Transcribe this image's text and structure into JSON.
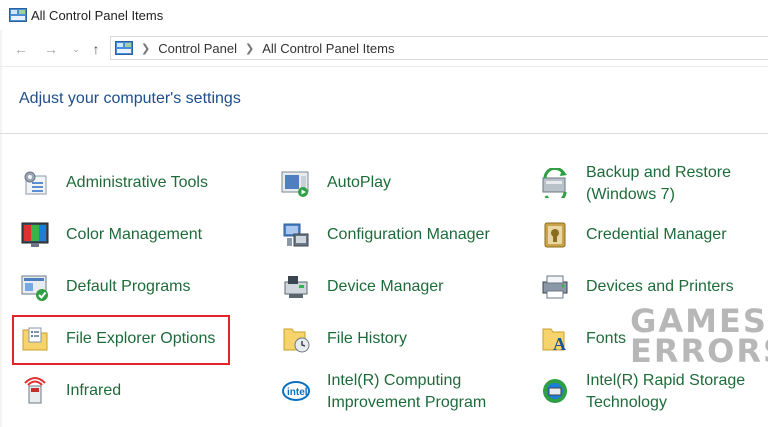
{
  "window": {
    "title": "All Control Panel Items"
  },
  "address_bar": {
    "crumbs": [
      "Control Panel",
      "All Control Panel Items"
    ]
  },
  "main": {
    "heading": "Adjust your computer's settings"
  },
  "items": [
    {
      "label": "Administrative Tools"
    },
    {
      "label": "AutoPlay"
    },
    {
      "label": "Backup and Restore",
      "label2": "(Windows 7)"
    },
    {
      "label": "Color Management"
    },
    {
      "label": "Configuration Manager"
    },
    {
      "label": "Credential Manager"
    },
    {
      "label": "Default Programs"
    },
    {
      "label": "Device Manager"
    },
    {
      "label": "Devices and Printers"
    },
    {
      "label": "File Explorer Options"
    },
    {
      "label": "File History"
    },
    {
      "label": "Fonts"
    },
    {
      "label": "Infrared"
    },
    {
      "label": "Intel(R) Computing",
      "label2": "Improvement Program"
    },
    {
      "label": "Intel(R) Rapid Storage",
      "label2": "Technology"
    }
  ],
  "watermark": {
    "line1": "GAMES",
    "line2": "ERRORS"
  },
  "colors": {
    "link": "#1e6b3a",
    "heading": "#1e4e8c",
    "highlight_border": "#e3222a"
  }
}
